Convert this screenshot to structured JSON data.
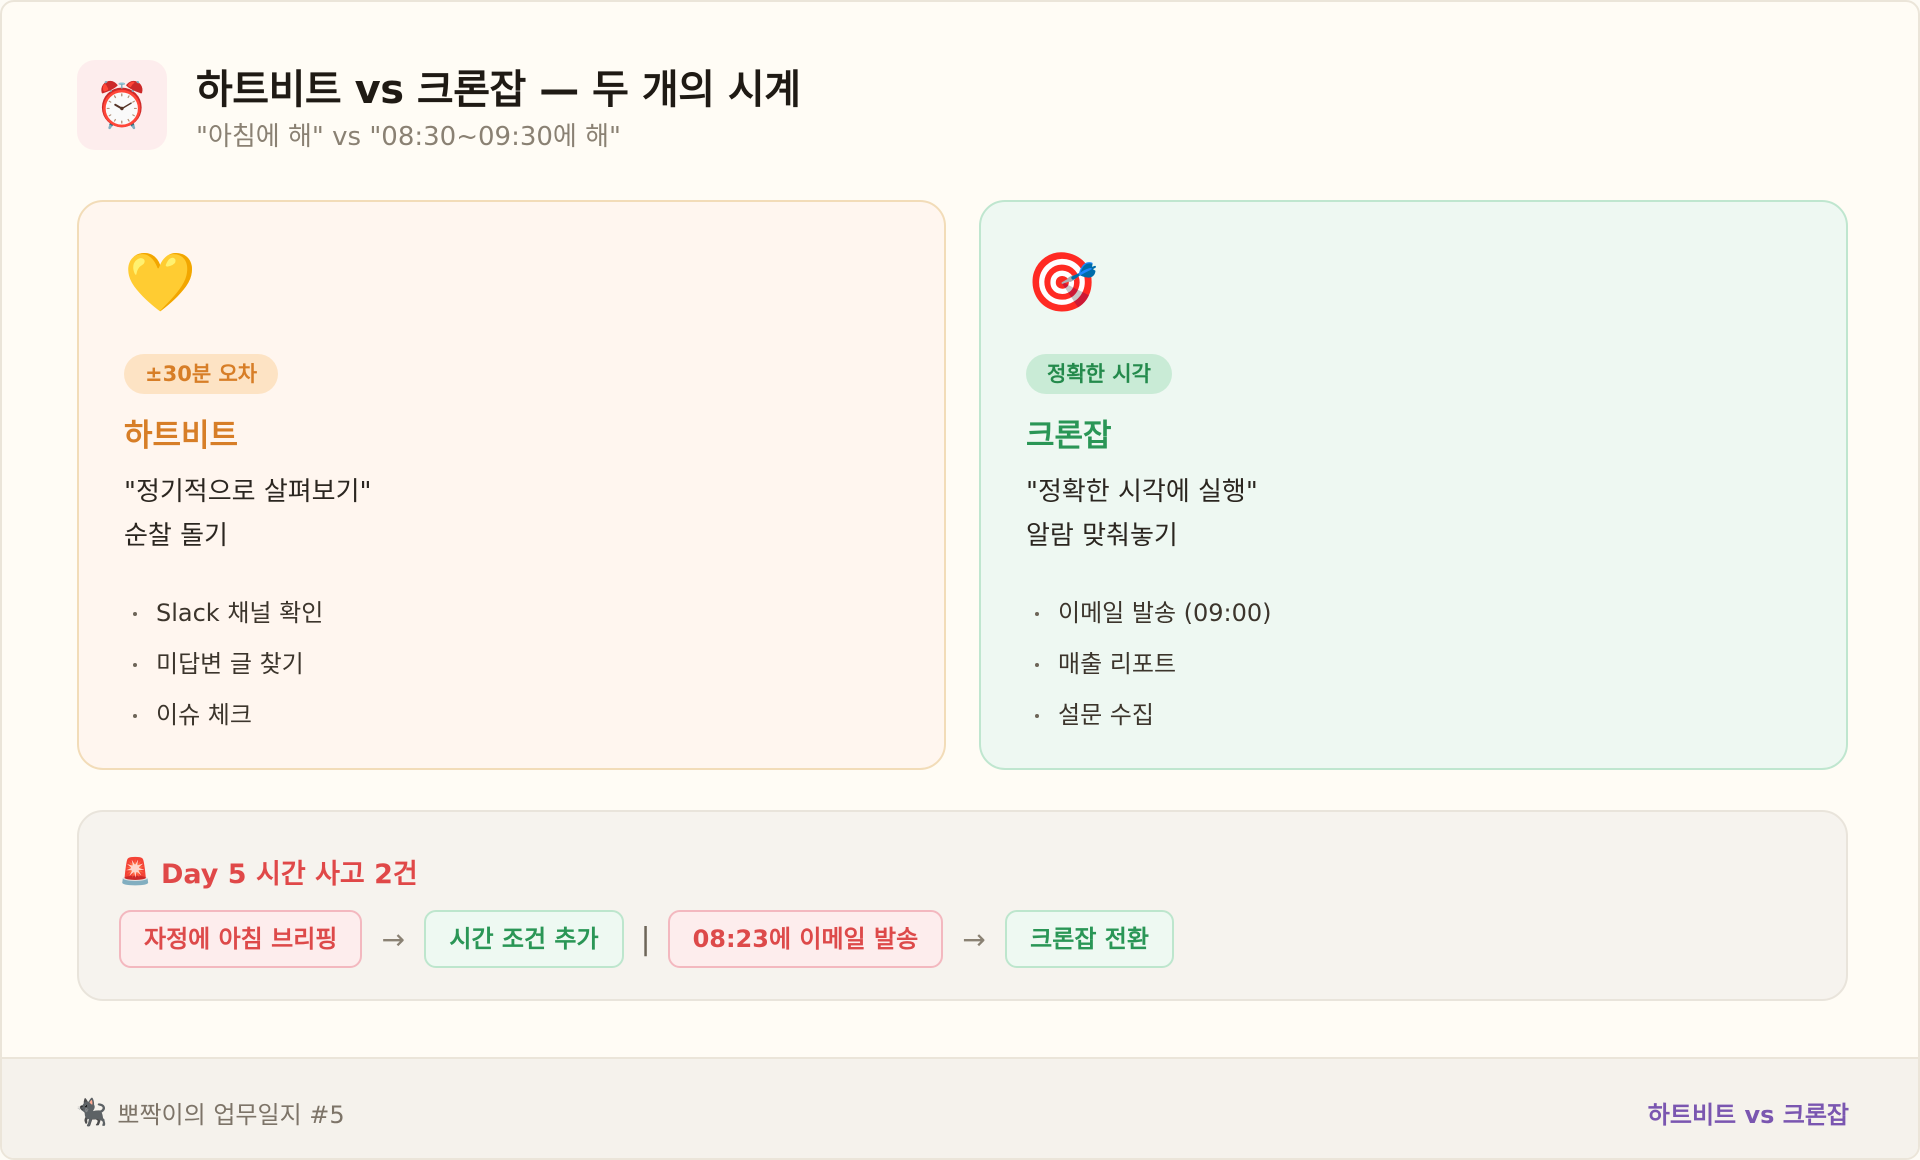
{
  "header": {
    "icon": "alarm-clock-icon",
    "icon_glyph": "⏰",
    "title": "하트비트 vs 크론잡 — 두 개의 시계",
    "subtitle": "\"아침에 해\" vs \"08:30~09:30에 해\""
  },
  "cards": {
    "heartbeat": {
      "icon": "yellow-heart-icon",
      "icon_glyph": "💛",
      "badge": "±30분 오차",
      "title": "하트비트",
      "quote": "\"정기적으로 살펴보기\"",
      "desc": "순찰 돌기",
      "bullets": [
        "Slack 채널 확인",
        "미답변 글 찾기",
        "이슈 체크"
      ],
      "accent": "#d77e27"
    },
    "cron": {
      "icon": "target-dart-icon",
      "icon_glyph": "🎯",
      "badge": "정확한 시각",
      "title": "크론잡",
      "quote": "\"정확한 시각에 실행\"",
      "desc": "알람 맞춰놓기",
      "bullets": [
        "이메일 발송 (09:00)",
        "매출 리포트",
        "설문 수집"
      ],
      "accent": "#2a9656"
    }
  },
  "incident": {
    "icon": "siren-icon",
    "icon_glyph": "🚨",
    "title": "Day 5 시간 사고 2건",
    "flow": {
      "step1": "자정에 아침 브리핑",
      "step2": "시간 조건 추가",
      "divider": "|",
      "step3": "08:23에 이메일 발송",
      "step4": "크론잡 전환",
      "arrow": "→"
    }
  },
  "footer": {
    "icon": "black-cat-icon",
    "icon_glyph": "🐈‍⬛",
    "left_text": "뽀짝이의 업무일지 #5",
    "right_text": "하트비트 vs 크론잡"
  }
}
